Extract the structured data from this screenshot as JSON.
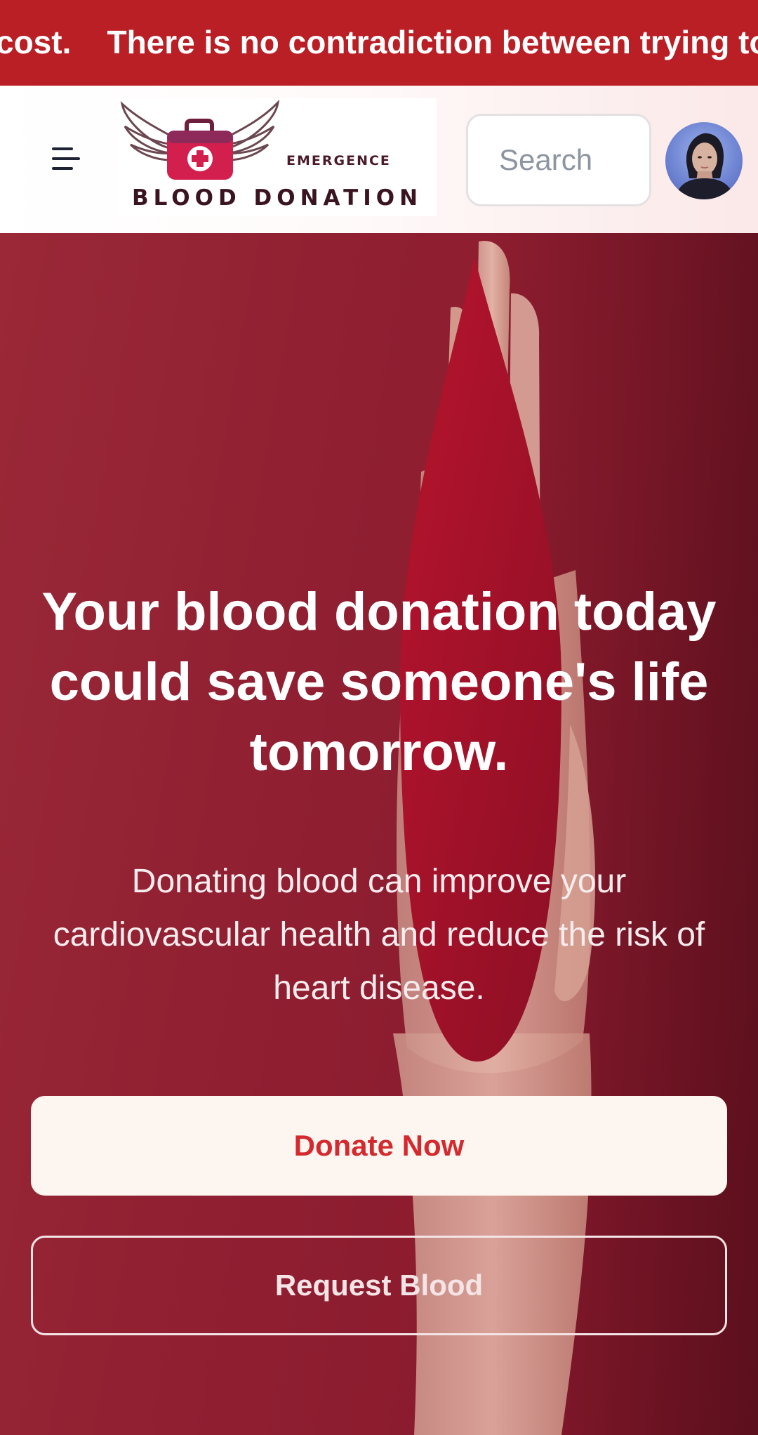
{
  "banner": {
    "marquee_text": "cost.    There is no contradiction between trying to"
  },
  "header": {
    "menu_icon": "menu-icon",
    "logo": {
      "top_text": "EMERGENCE",
      "bottom_text": "BLOOD DONATION",
      "icon": "winged-medical-kit-icon"
    },
    "search": {
      "placeholder": "Search",
      "value": ""
    },
    "avatar": "user-avatar"
  },
  "hero": {
    "title": "Your blood donation today could save someone's life tomorrow.",
    "subtitle": "Donating blood can improve your cardiovascular health and reduce the risk of heart disease.",
    "donate_label": "Donate Now",
    "request_label": "Request Blood"
  },
  "colors": {
    "banner_bg": "#b91f24",
    "hero_bg": "#8e1a2c",
    "donate_text": "#d42a2f",
    "donate_bg": "#fdf6f0"
  }
}
